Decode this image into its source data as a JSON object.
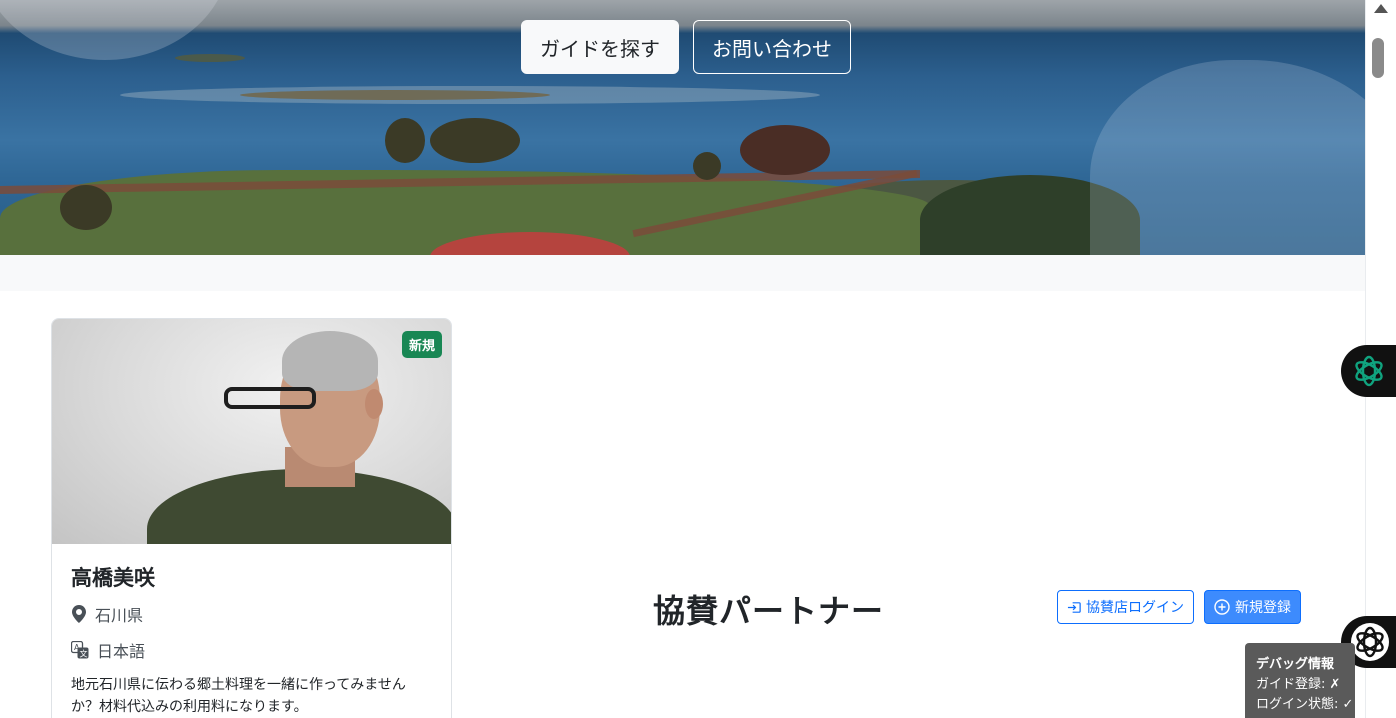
{
  "hero": {
    "find_guide_label": "ガイドを探す",
    "contact_label": "お問い合わせ"
  },
  "guide_card": {
    "badge": "新規",
    "name": "高橋美咲",
    "prefecture": "石川県",
    "language": "日本語",
    "description": "地元石川県に伝わる郷土料理を一緒に作ってみませんか？材料代込みの利用料になります。"
  },
  "partners": {
    "title": "協賛パートナー",
    "login_label": "協賛店ログイン",
    "register_label": "新規登録"
  },
  "debug": {
    "title": "デバッグ情報",
    "guide_registered": "ガイド登録: ✗",
    "login_state": "ログイン状態: ✓"
  },
  "colors": {
    "primary": "#0d6efd",
    "success_badge": "#198754"
  },
  "icons": {
    "location": "map-pin-icon",
    "language": "translate-icon",
    "login": "sign-in-icon",
    "register": "plus-circle-icon",
    "chat": "openai-icon",
    "assistant": "ai-assistant-icon"
  }
}
